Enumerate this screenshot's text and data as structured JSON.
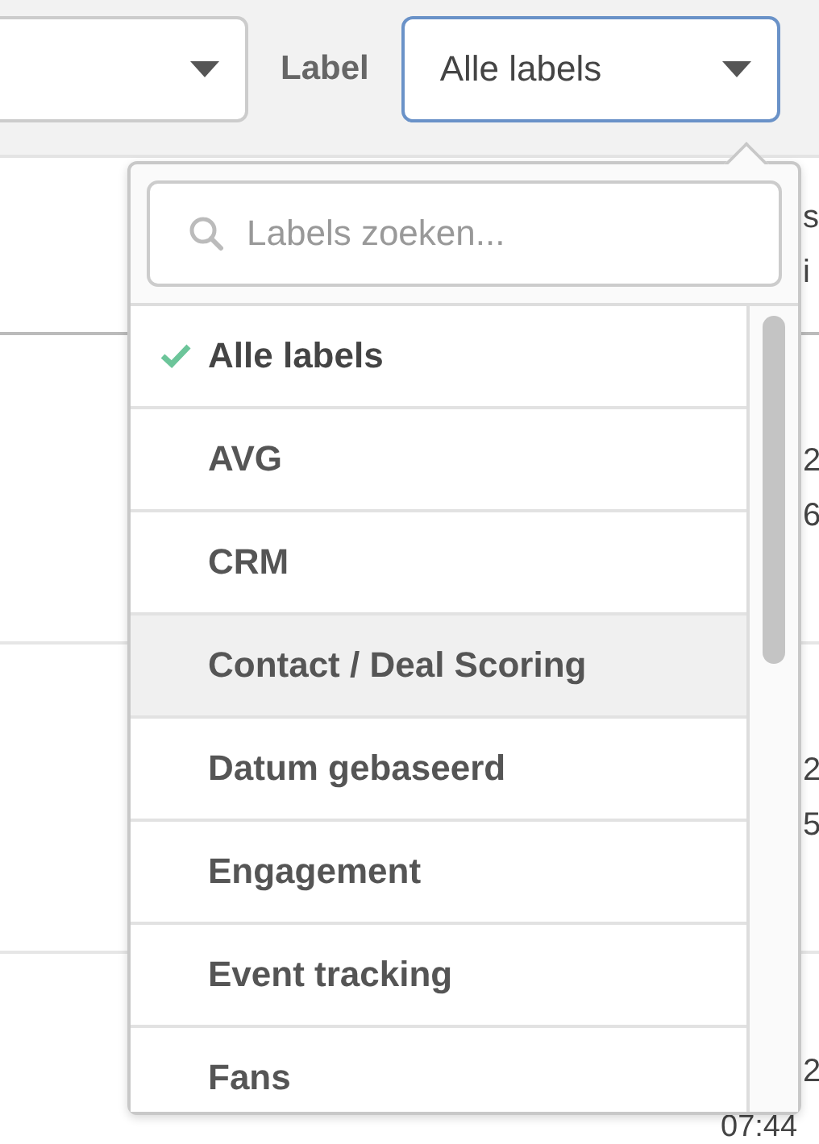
{
  "filters": {
    "label_text": "Label",
    "label_select": {
      "value": "Alle labels",
      "open": true
    }
  },
  "table": {
    "rows": [
      {
        "lines": [
          {
            "text": "s",
            "kind": "edge"
          },
          {
            "text": "i",
            "kind": "edge"
          }
        ]
      },
      {
        "lines": [
          {
            "text": "2",
            "kind": "edge"
          },
          {
            "text": "6",
            "kind": "edge"
          }
        ]
      },
      {
        "lines": [
          {
            "text": "2",
            "kind": "edge"
          },
          {
            "text": "5",
            "kind": "edge"
          }
        ]
      },
      {
        "lines": [
          {
            "text": "2",
            "kind": "edge"
          },
          {
            "text": "07:44",
            "kind": "wide"
          }
        ]
      }
    ]
  },
  "dropdown": {
    "search": {
      "placeholder": "Labels zoeken..."
    },
    "items": [
      {
        "label": "Alle labels",
        "selected": true,
        "hovered": false
      },
      {
        "label": "AVG",
        "selected": false,
        "hovered": false
      },
      {
        "label": "CRM",
        "selected": false,
        "hovered": false
      },
      {
        "label": "Contact / Deal Scoring",
        "selected": false,
        "hovered": true
      },
      {
        "label": "Datum gebaseerd",
        "selected": false,
        "hovered": false
      },
      {
        "label": "Engagement",
        "selected": false,
        "hovered": false
      },
      {
        "label": "Event tracking",
        "selected": false,
        "hovered": false
      },
      {
        "label": "Fans",
        "selected": false,
        "hovered": false
      }
    ]
  }
}
